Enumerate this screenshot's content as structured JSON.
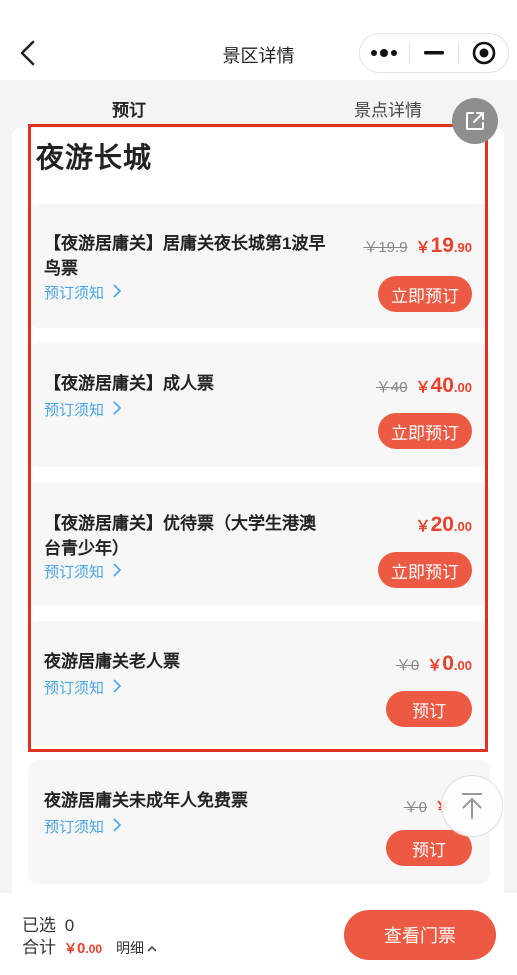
{
  "nav": {
    "title": "景区详情"
  },
  "tabs": [
    {
      "label": "预订"
    },
    {
      "label": "景点详情"
    }
  ],
  "scenic": {
    "title": "夜游长城"
  },
  "tickets": [
    {
      "name": "【夜游居庸关】居庸关夜长城第1波早鸟票",
      "notice": "预订须知",
      "original_price": "￥19.9",
      "price_symbol": "￥",
      "price_int": "19",
      "price_dec": ".90",
      "button": "立即预订"
    },
    {
      "name": "【夜游居庸关】成人票",
      "notice": "预订须知",
      "original_price": "￥40",
      "price_symbol": "￥",
      "price_int": "40",
      "price_dec": ".00",
      "button": "立即预订"
    },
    {
      "name": "【夜游居庸关】优待票（大学生港澳台青少年）",
      "notice": "预订须知",
      "original_price": "",
      "price_symbol": "￥",
      "price_int": "20",
      "price_dec": ".00",
      "button": "立即预订"
    },
    {
      "name": "夜游居庸关老人票",
      "notice": "预订须知",
      "original_price": "￥0",
      "price_symbol": "￥",
      "price_int": "0",
      "price_dec": ".00",
      "button": "预订"
    },
    {
      "name": "夜游居庸关未成年人免费票",
      "notice": "预订须知",
      "original_price": "￥0",
      "price_symbol": "￥",
      "price_int": "",
      "price_dec": "",
      "button": "预订"
    }
  ],
  "bottom": {
    "selected_label": "已选",
    "selected_count": "0",
    "total_label": "合计",
    "total_symbol": "￥",
    "total_int": "0",
    "total_dec": ".00",
    "detail_label": "明细",
    "view_button": "查看门票"
  },
  "colors": {
    "accent": "#ec5a44",
    "price": "#e8412c",
    "link": "#4aa5e8",
    "highlight_box": "#e03127"
  },
  "icons": {
    "back": "back-arrow-icon",
    "more": "more-dots-icon",
    "minimize": "minimize-icon",
    "close": "target-close-icon",
    "share": "share-icon",
    "scroll_top": "scroll-top-icon"
  }
}
